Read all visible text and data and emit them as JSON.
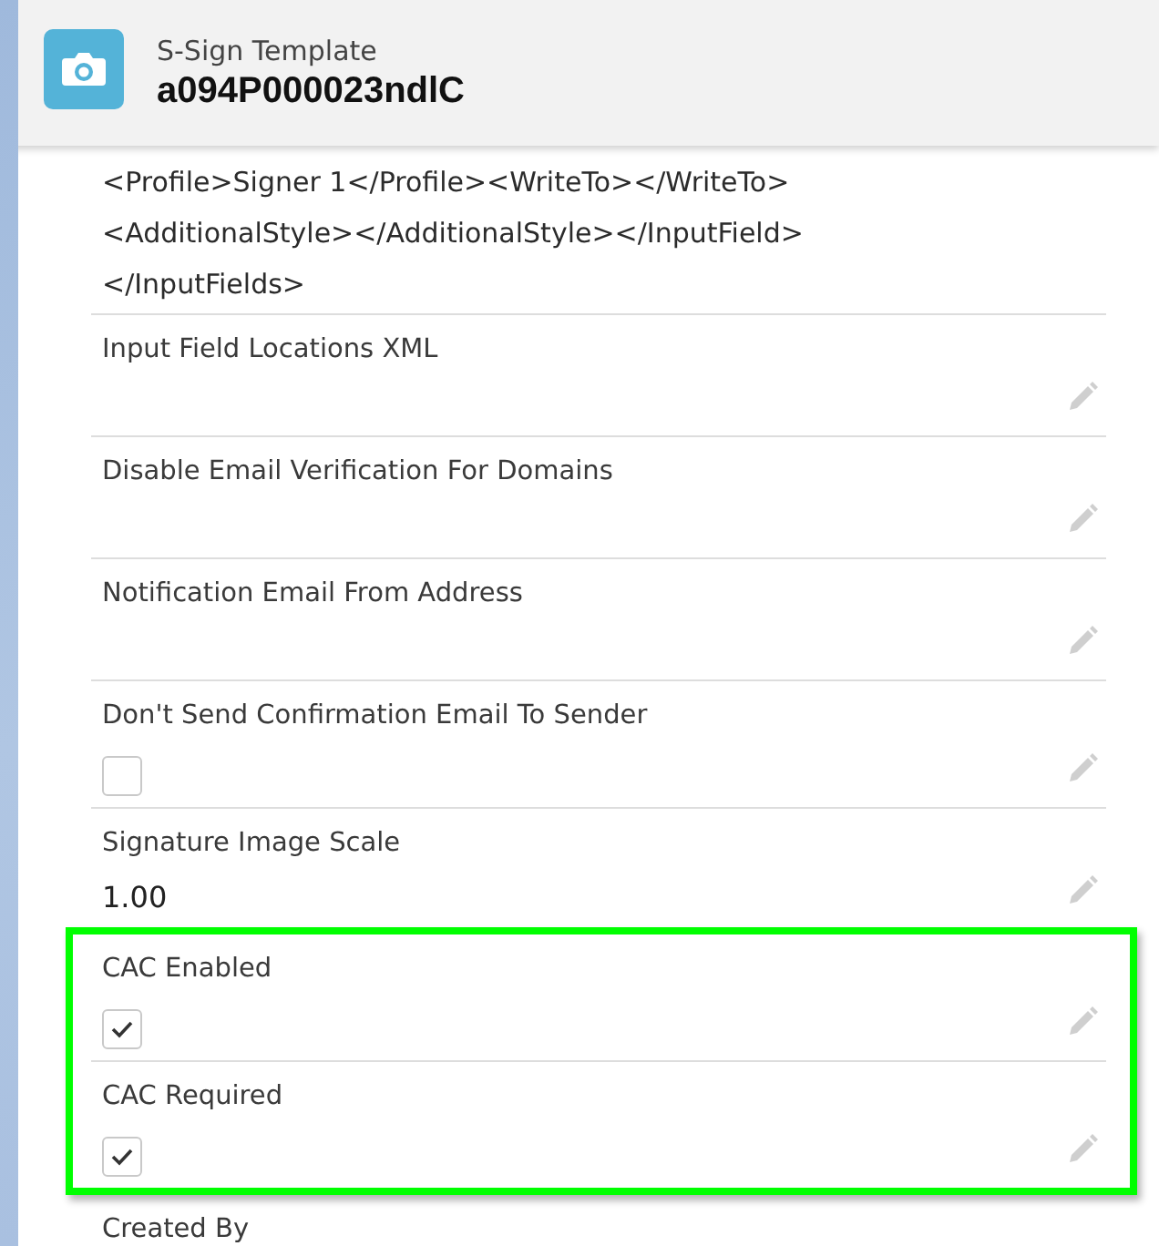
{
  "header": {
    "object_type": "S-Sign Template",
    "record_name": "a094P000023ndlC"
  },
  "xml_lines": [
    "<Profile>Signer 1</Profile><WriteTo></WriteTo>",
    "<AdditionalStyle></AdditionalStyle></InputField>",
    "</InputFields>"
  ],
  "fields": [
    {
      "kind": "text",
      "label": "Input Field Locations XML",
      "highlighted": false
    },
    {
      "kind": "text",
      "label": "Disable Email Verification For Domains",
      "highlighted": false
    },
    {
      "kind": "text",
      "label": "Notification Email From Address",
      "highlighted": false
    },
    {
      "kind": "checkbox",
      "label": "Don't Send Confirmation Email To Sender",
      "checked": false,
      "highlighted": false
    },
    {
      "kind": "text",
      "label": "Signature Image Scale",
      "value": "1.00",
      "highlighted": false
    },
    {
      "kind": "checkbox",
      "label": "CAC Enabled",
      "checked": true,
      "highlighted": true
    },
    {
      "kind": "checkbox",
      "label": "CAC Required",
      "checked": true,
      "highlighted": true
    },
    {
      "kind": "label_only",
      "label": "Created By",
      "highlighted": false
    }
  ]
}
